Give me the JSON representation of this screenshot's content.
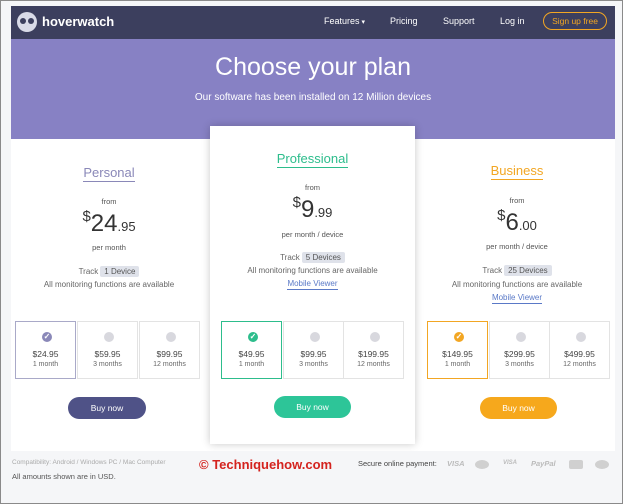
{
  "nav": {
    "brand": "hoverwatch",
    "links": [
      "Features",
      "Pricing",
      "Support",
      "Log in"
    ],
    "signup": "Sign up free"
  },
  "hero": {
    "title": "Choose your plan",
    "subtitle": "Our software has been installed on 12 Million devices"
  },
  "plans": [
    {
      "name": "Personal",
      "from": "from",
      "currency": "$",
      "int": "24",
      "dec": ".95",
      "per": "per month",
      "track_label": "Track",
      "track_badge": "1 Device",
      "monitoring": "All monitoring functions are available",
      "mobile_viewer": "",
      "color": "#8a88b8",
      "options": [
        {
          "price": "$24.95",
          "label": "1 month",
          "selected": true
        },
        {
          "price": "$59.95",
          "label": "3 months",
          "selected": false
        },
        {
          "price": "$99.95",
          "label": "12 months",
          "selected": false
        }
      ],
      "buy": "Buy now",
      "buy_color": "#4f5287"
    },
    {
      "name": "Professional",
      "from": "from",
      "currency": "$",
      "int": "9",
      "dec": ".99",
      "per": "per month / device",
      "track_label": "Track",
      "track_badge": "5 Devices",
      "monitoring": "All monitoring functions are available",
      "mobile_viewer": "Mobile Viewer",
      "color": "#2dbd8c",
      "options": [
        {
          "price": "$49.95",
          "label": "1 month",
          "selected": true
        },
        {
          "price": "$99.95",
          "label": "3 months",
          "selected": false
        },
        {
          "price": "$199.95",
          "label": "12 months",
          "selected": false
        }
      ],
      "buy": "Buy now",
      "buy_color": "#2dc598"
    },
    {
      "name": "Business",
      "from": "from",
      "currency": "$",
      "int": "6",
      "dec": ".00",
      "per": "per month / device",
      "track_label": "Track",
      "track_badge": "25 Devices",
      "monitoring": "All monitoring functions are available",
      "mobile_viewer": "Mobile Viewer",
      "color": "#f2a623",
      "options": [
        {
          "price": "$149.95",
          "label": "1 month",
          "selected": true
        },
        {
          "price": "$299.95",
          "label": "3 months",
          "selected": false
        },
        {
          "price": "$499.95",
          "label": "12 months",
          "selected": false
        }
      ],
      "buy": "Buy now",
      "buy_color": "#f6a81c"
    }
  ],
  "footer": {
    "compat": "Compatibility: Android / Windows PC / Mac Computer",
    "usd": "All amounts shown are in USD.",
    "watermark": "© Techniquehow.com",
    "secure": "Secure online payment:",
    "payments": [
      "VISA",
      "VISA",
      "PayPal"
    ]
  },
  "colors": {
    "nav_bg": "#3c3f5e",
    "hero_bg": "#8781c4",
    "accent_orange": "#f2a623"
  }
}
